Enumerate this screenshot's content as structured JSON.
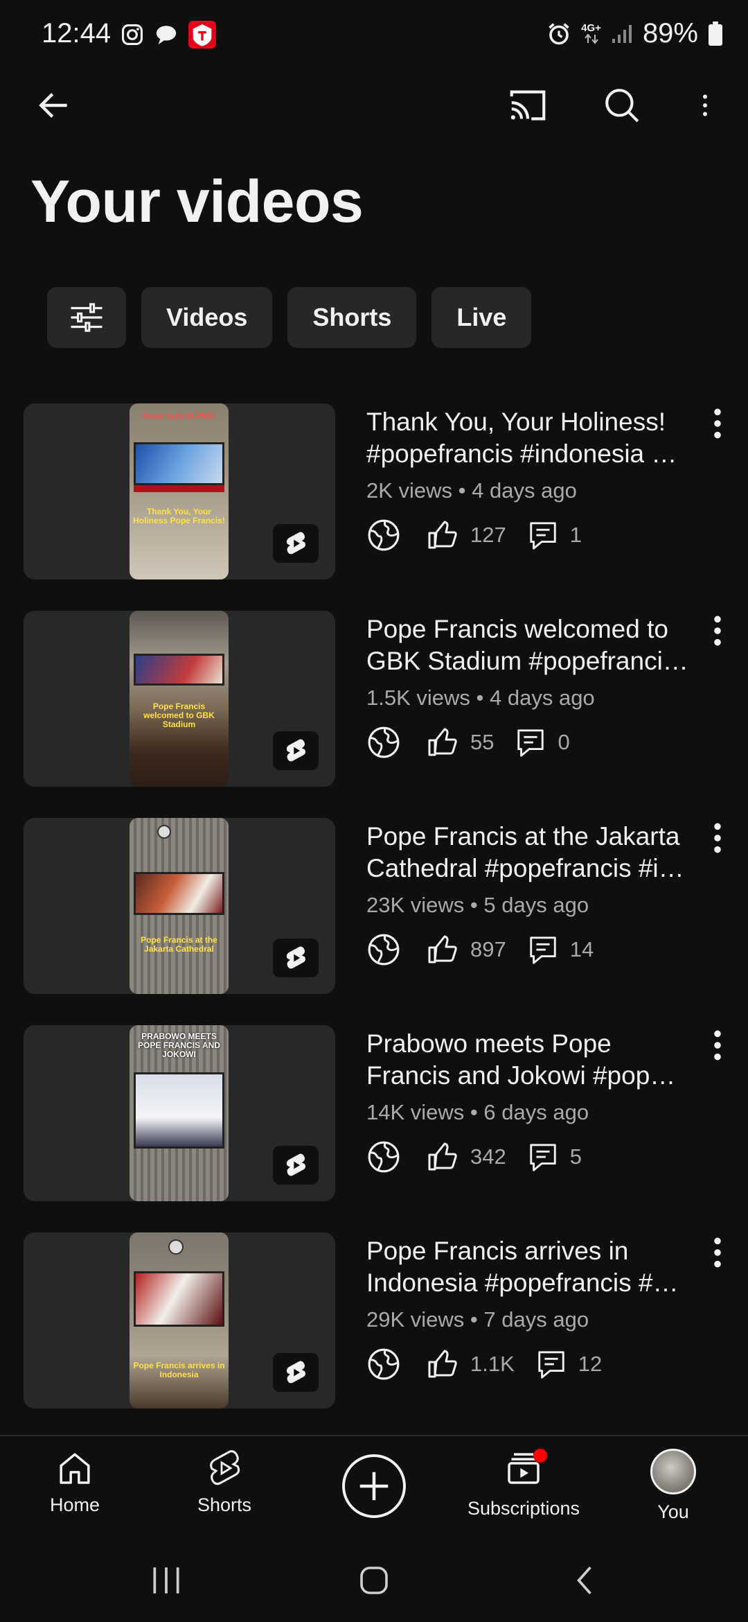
{
  "status": {
    "time": "12:44",
    "network": "4G+",
    "battery": "89%"
  },
  "header": {
    "title": "Your videos"
  },
  "chips": [
    {
      "label": "Videos"
    },
    {
      "label": "Shorts"
    },
    {
      "label": "Live"
    }
  ],
  "videos": [
    {
      "title": "Thank You, Your Holiness! #popefrancis #indonesia …",
      "views": "2K views",
      "age": "4 days ago",
      "likes": "127",
      "comments": "1",
      "thumb_top": "Good luck in PNG!",
      "thumb_bottom": "Thank You, Your Holiness Pope Francis!"
    },
    {
      "title": "Pope Francis welcomed to GBK Stadium #popefranci…",
      "views": "1.5K views",
      "age": "4 days ago",
      "likes": "55",
      "comments": "0",
      "thumb_top": "",
      "thumb_bottom": "Pope Francis welcomed to GBK Stadium"
    },
    {
      "title": "Pope Francis at the Jakarta Cathedral #popefrancis #i…",
      "views": "23K views",
      "age": "5 days ago",
      "likes": "897",
      "comments": "14",
      "thumb_top": "",
      "thumb_bottom": "Pope Francis at the Jakarta Cathedral"
    },
    {
      "title": "Prabowo meets Pope Francis and Jokowi #pop…",
      "views": "14K views",
      "age": "6 days ago",
      "likes": "342",
      "comments": "5",
      "thumb_top": "PRABOWO MEETS POPE FRANCIS AND JOKOWI",
      "thumb_bottom": ""
    },
    {
      "title": "Pope Francis arrives in Indonesia #popefrancis #…",
      "views": "29K views",
      "age": "7 days ago",
      "likes": "1.1K",
      "comments": "12",
      "thumb_top": "",
      "thumb_bottom": "Pope Francis arrives in Indonesia"
    }
  ],
  "nav": {
    "home": "Home",
    "shorts": "Shorts",
    "subscriptions": "Subscriptions",
    "you": "You"
  },
  "colors": {
    "background": "#0f0f0f",
    "chip": "#272727",
    "secondary_text": "#aaaaaa",
    "notification": "#ff0000"
  }
}
